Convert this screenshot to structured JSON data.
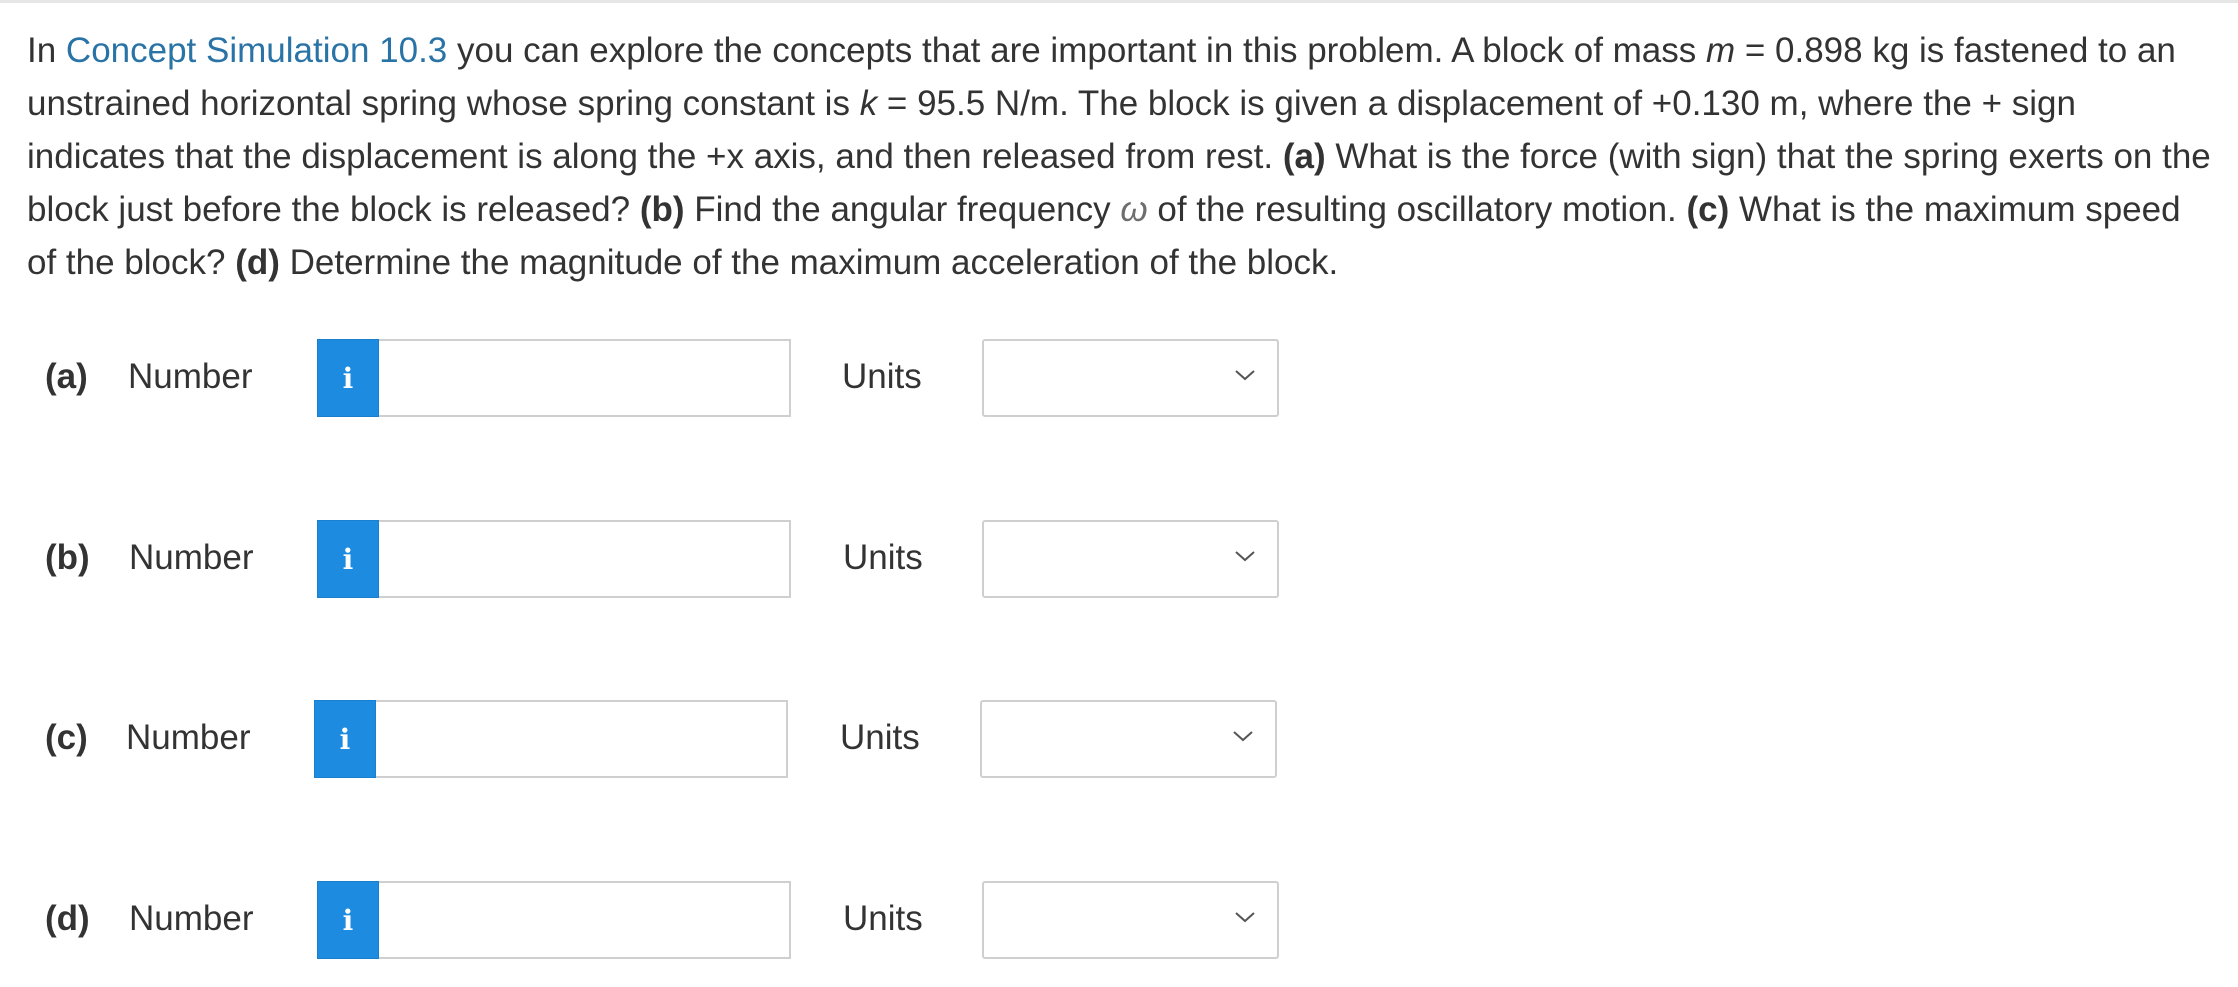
{
  "question": {
    "intro_prefix": "In ",
    "sim_link": "Concept Simulation 10.3",
    "s1": " you can explore the concepts that are important in this problem. A block of mass ",
    "var_m": "m",
    "s2": " = 0.898 kg is fastened to an unstrained horizontal spring whose spring constant is ",
    "var_k": "k",
    "s3": " = 95.5 N/m. The block is given a displacement of +0.130 m, where the + sign indicates that the displacement is along the +x axis, and then released from rest. ",
    "pa": "(a)",
    "s4": " What is the force (with sign) that the spring exerts on the block just before the block is released? ",
    "pb": "(b)",
    "s5": " Find the angular frequency ",
    "omega": "ω",
    "s6": " of the resulting oscillatory motion. ",
    "pc": "(c)",
    "s7": " What is the maximum speed of the block? ",
    "pd": "(d)",
    "s8": " Determine the magnitude of the maximum acceleration of the block."
  },
  "parts": [
    {
      "label": "(a)",
      "number_label": "Number",
      "info_glyph": "i",
      "number_value": "",
      "units_label": "Units",
      "units_value": ""
    },
    {
      "label": "(b)",
      "number_label": "Number",
      "info_glyph": "i",
      "number_value": "",
      "units_label": "Units",
      "units_value": ""
    },
    {
      "label": "(c)",
      "number_label": "Number",
      "info_glyph": "i",
      "number_value": "",
      "units_label": "Units",
      "units_value": ""
    },
    {
      "label": "(d)",
      "number_label": "Number",
      "info_glyph": "i",
      "number_value": "",
      "units_label": "Units",
      "units_value": ""
    }
  ],
  "icons": {
    "info": "info-icon",
    "dropdown": "chevron-down-icon"
  },
  "colors": {
    "link": "#2a73a6",
    "info_button": "#1d8ce0",
    "text": "#333333",
    "border": "#cfcfcf"
  }
}
